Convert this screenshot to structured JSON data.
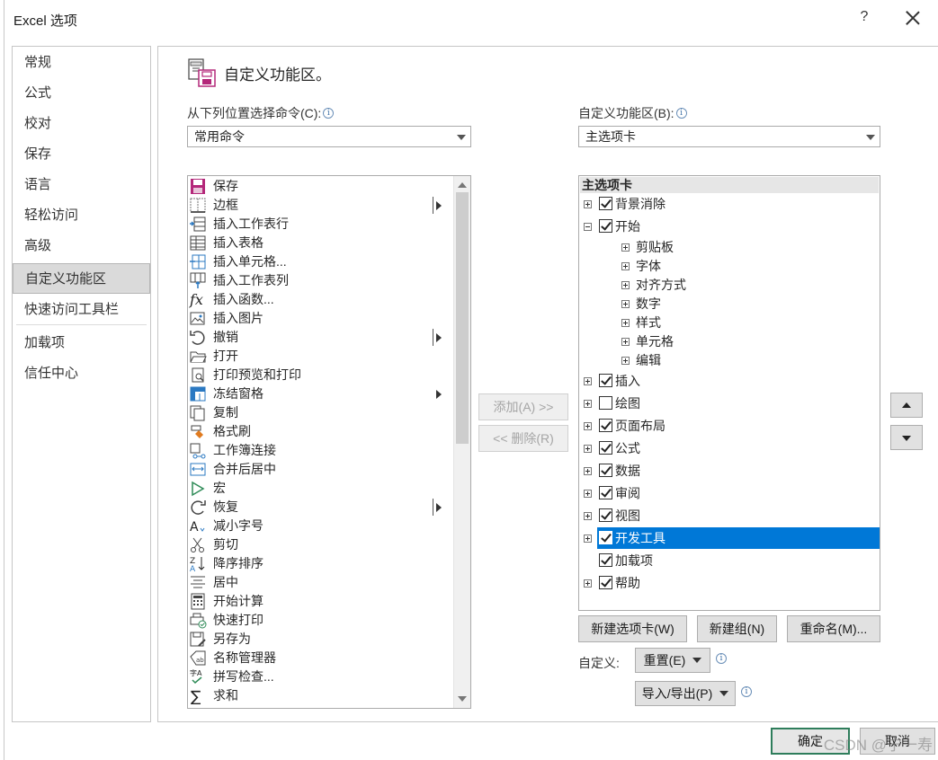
{
  "window": {
    "title": "Excel 选项",
    "help": "?"
  },
  "nav": {
    "items": [
      "常规",
      "公式",
      "校对",
      "保存",
      "语言",
      "轻松访问",
      "高级",
      "自定义功能区",
      "快速访问工具栏",
      "加载项",
      "信任中心"
    ],
    "selected": "自定义功能区"
  },
  "header": {
    "title": "自定义功能区。",
    "icon": "customize-ribbon-icon"
  },
  "left": {
    "label": "从下列位置选择命令(C):",
    "combo_value": "常用命令",
    "commands": [
      {
        "label": "保存",
        "icon": "save-icon",
        "submenu": false
      },
      {
        "label": "边框",
        "icon": "border-icon",
        "submenu": true
      },
      {
        "label": "插入工作表行",
        "icon": "insert-row-icon",
        "submenu": false
      },
      {
        "label": "插入表格",
        "icon": "insert-table-icon",
        "submenu": false
      },
      {
        "label": "插入单元格...",
        "icon": "insert-cells-icon",
        "submenu": false
      },
      {
        "label": "插入工作表列",
        "icon": "insert-column-icon",
        "submenu": false
      },
      {
        "label": "插入函数...",
        "icon": "function-icon",
        "submenu": false
      },
      {
        "label": "插入图片",
        "icon": "picture-icon",
        "submenu": false
      },
      {
        "label": "撤销",
        "icon": "undo-icon",
        "submenu": true
      },
      {
        "label": "打开",
        "icon": "open-folder-icon",
        "submenu": false
      },
      {
        "label": "打印预览和打印",
        "icon": "print-preview-icon",
        "submenu": false
      },
      {
        "label": "冻结窗格",
        "icon": "freeze-panes-icon",
        "submenu": "arrow"
      },
      {
        "label": "复制",
        "icon": "copy-icon",
        "submenu": false
      },
      {
        "label": "格式刷",
        "icon": "format-painter-icon",
        "submenu": false
      },
      {
        "label": "工作簿连接",
        "icon": "connections-icon",
        "submenu": false
      },
      {
        "label": "合并后居中",
        "icon": "merge-center-icon",
        "submenu": false
      },
      {
        "label": "宏",
        "icon": "macro-play-icon",
        "submenu": false
      },
      {
        "label": "恢复",
        "icon": "redo-icon",
        "submenu": true
      },
      {
        "label": "减小字号",
        "icon": "decrease-font-icon",
        "submenu": false
      },
      {
        "label": "剪切",
        "icon": "scissors-icon",
        "submenu": false
      },
      {
        "label": "降序排序",
        "icon": "sort-descending-icon",
        "submenu": false
      },
      {
        "label": "居中",
        "icon": "align-center-icon",
        "submenu": false
      },
      {
        "label": "开始计算",
        "icon": "calculator-icon",
        "submenu": false
      },
      {
        "label": "快速打印",
        "icon": "quick-print-icon",
        "submenu": false
      },
      {
        "label": "另存为",
        "icon": "save-as-icon",
        "submenu": false
      },
      {
        "label": "名称管理器",
        "icon": "name-manager-icon",
        "submenu": false
      },
      {
        "label": "拼写检查...",
        "icon": "spell-check-icon",
        "submenu": false
      },
      {
        "label": "求和",
        "icon": "sum-icon",
        "submenu": false
      }
    ]
  },
  "middle": {
    "add_label": "添加(A) >>",
    "remove_label": "<< 删除(R)"
  },
  "right": {
    "label": "自定义功能区(B):",
    "combo_value": "主选项卡",
    "tree_header": "主选项卡",
    "tree": [
      {
        "label": "背景消除",
        "level": 0,
        "expander": "plus",
        "checked": true,
        "selected": false
      },
      {
        "label": "开始",
        "level": 0,
        "expander": "minus",
        "checked": true,
        "selected": false
      },
      {
        "label": "剪贴板",
        "level": 1,
        "expander": "plus",
        "checked": null,
        "selected": false
      },
      {
        "label": "字体",
        "level": 1,
        "expander": "plus",
        "checked": null,
        "selected": false
      },
      {
        "label": "对齐方式",
        "level": 1,
        "expander": "plus",
        "checked": null,
        "selected": false
      },
      {
        "label": "数字",
        "level": 1,
        "expander": "plus",
        "checked": null,
        "selected": false
      },
      {
        "label": "样式",
        "level": 1,
        "expander": "plus",
        "checked": null,
        "selected": false
      },
      {
        "label": "单元格",
        "level": 1,
        "expander": "plus",
        "checked": null,
        "selected": false
      },
      {
        "label": "编辑",
        "level": 1,
        "expander": "plus",
        "checked": null,
        "selected": false
      },
      {
        "label": "插入",
        "level": 0,
        "expander": "plus",
        "checked": true,
        "selected": false
      },
      {
        "label": "绘图",
        "level": 0,
        "expander": "plus",
        "checked": false,
        "selected": false
      },
      {
        "label": "页面布局",
        "level": 0,
        "expander": "plus",
        "checked": true,
        "selected": false
      },
      {
        "label": "公式",
        "level": 0,
        "expander": "plus",
        "checked": true,
        "selected": false
      },
      {
        "label": "数据",
        "level": 0,
        "expander": "plus",
        "checked": true,
        "selected": false
      },
      {
        "label": "审阅",
        "level": 0,
        "expander": "plus",
        "checked": true,
        "selected": false
      },
      {
        "label": "视图",
        "level": 0,
        "expander": "plus",
        "checked": true,
        "selected": false
      },
      {
        "label": "开发工具",
        "level": 0,
        "expander": "plus",
        "checked": true,
        "selected": true
      },
      {
        "label": "加载项",
        "level": 0,
        "expander": "none",
        "checked": true,
        "selected": false
      },
      {
        "label": "帮助",
        "level": 0,
        "expander": "plus",
        "checked": true,
        "selected": false
      }
    ],
    "new_tab_label": "新建选项卡(W)",
    "new_group_label": "新建组(N)",
    "rename_label": "重命名(M)...",
    "customize_label": "自定义:",
    "reset_label": "重置(E)",
    "import_export_label": "导入/导出(P)"
  },
  "footer": {
    "ok_label": "确定",
    "cancel_label": "取消"
  },
  "watermark": "CSDN @宁一寿",
  "colors": {
    "selection": "#0078d7",
    "ok_border": "#2e7d5b"
  }
}
